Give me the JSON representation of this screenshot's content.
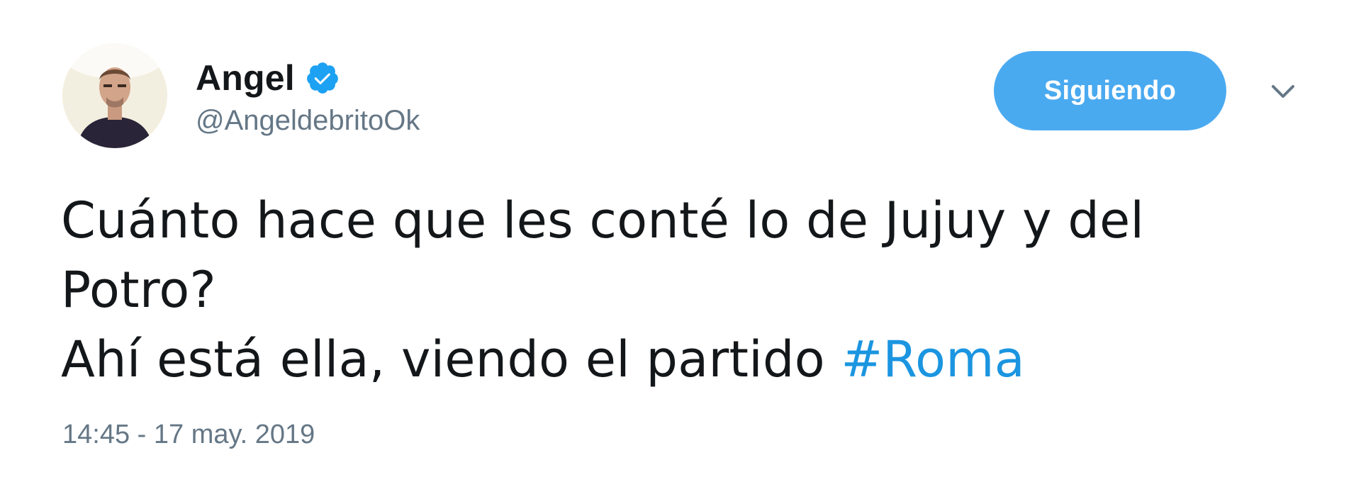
{
  "user": {
    "display_name": "Angel",
    "handle": "@AngeldebritoOk",
    "avatar_icon": "profile-photo",
    "verified_icon": "verified-badge-icon"
  },
  "actions": {
    "follow_label": "Siguiendo",
    "menu_icon": "chevron-down-icon"
  },
  "tweet": {
    "line1": "Cuánto hace que les conté lo de Jujuy y del",
    "line2": "Potro?",
    "line3_text": "Ahí está ella, viendo el partido ",
    "hashtag": "#Roma",
    "timestamp": "14:45 - 17 may. 2019"
  },
  "colors": {
    "accent": "#1b95e0",
    "button_bg": "#4aaaf0",
    "text": "#14171a",
    "muted": "#657786"
  }
}
